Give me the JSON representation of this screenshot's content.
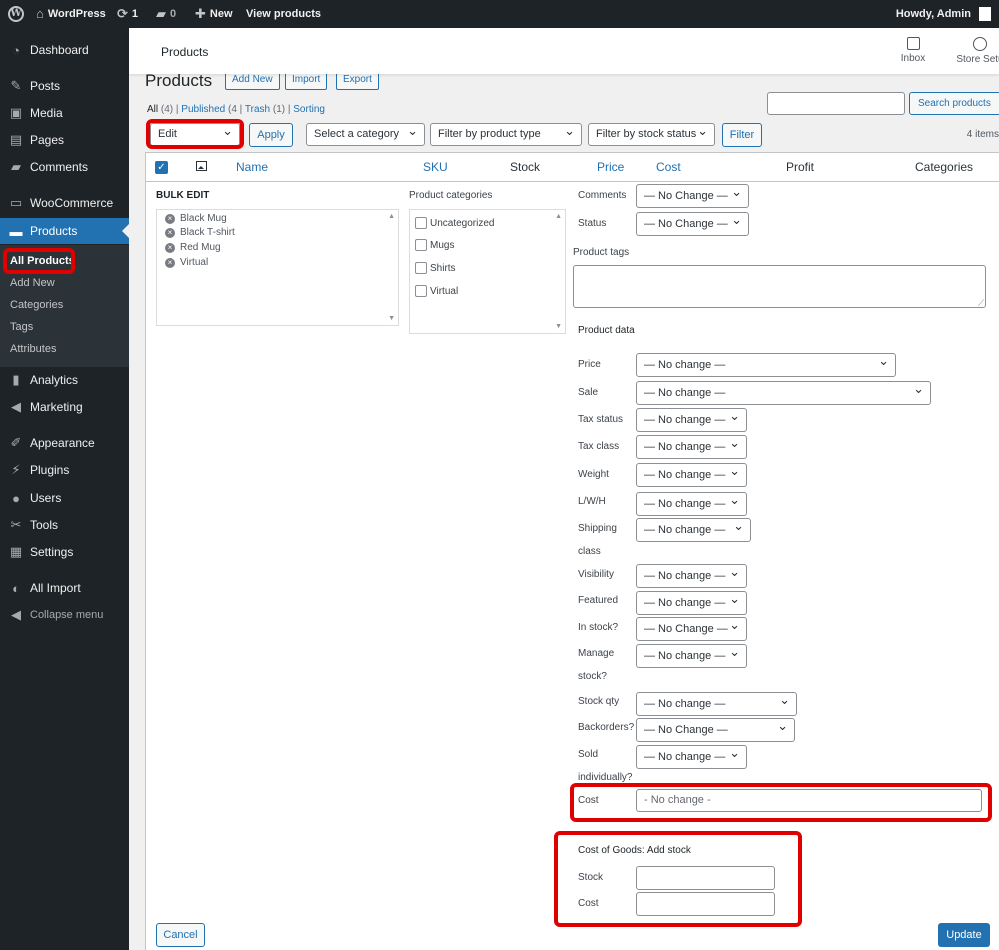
{
  "admin_bar": {
    "site_name": "WordPress",
    "updates_count": "1",
    "comments_count": "0",
    "new_label": "New",
    "view_label": "View products",
    "howdy": "Howdy, Admin"
  },
  "sidebar": {
    "items": [
      {
        "label": "Dashboard",
        "icon": "dashboard-icon"
      },
      {
        "label": "Posts",
        "icon": "pin-icon"
      },
      {
        "label": "Media",
        "icon": "media-icon"
      },
      {
        "label": "Pages",
        "icon": "pages-icon"
      },
      {
        "label": "Comments",
        "icon": "comment-icon"
      },
      {
        "label": "WooCommerce",
        "icon": "woo-icon"
      },
      {
        "label": "Products",
        "icon": "archive-icon"
      },
      {
        "label": "Analytics",
        "icon": "chart-icon"
      },
      {
        "label": "Marketing",
        "icon": "megaphone-icon"
      },
      {
        "label": "Appearance",
        "icon": "brush-icon"
      },
      {
        "label": "Plugins",
        "icon": "plug-icon"
      },
      {
        "label": "Users",
        "icon": "user-icon"
      },
      {
        "label": "Tools",
        "icon": "wrench-icon"
      },
      {
        "label": "Settings",
        "icon": "settings-icon"
      },
      {
        "label": "All Import",
        "icon": "import-icon"
      },
      {
        "label": "Collapse menu",
        "icon": "collapse-icon"
      }
    ],
    "submenu": [
      "All Products",
      "Add New",
      "Categories",
      "Tags",
      "Attributes"
    ]
  },
  "header": {
    "title": "Products",
    "inbox": "Inbox",
    "store_setup": "Store Setu"
  },
  "page": {
    "heading": "Products",
    "add_new": "Add New",
    "import": "Import",
    "export": "Export",
    "filters": {
      "all": "All",
      "all_count": "(4)",
      "published": "Published",
      "published_count": "(4",
      "trash": "Trash",
      "trash_count": "(1)",
      "sorting": "Sorting"
    },
    "search_button": "Search products",
    "bulk_action": "Edit",
    "apply": "Apply",
    "category_filter": "Select a category",
    "type_filter": "Filter by product type",
    "stock_filter": "Filter by stock status",
    "filter_button": "Filter",
    "items_count": "4 items"
  },
  "table": {
    "columns": [
      "Name",
      "SKU",
      "Stock",
      "Price",
      "Cost",
      "Profit",
      "Categories"
    ]
  },
  "bulk_edit": {
    "title": "BULK EDIT",
    "products": [
      "Black Mug",
      "Black T-shirt",
      "Red Mug",
      "Virtual"
    ],
    "categories_label": "Product categories",
    "categories": [
      "Uncategorized",
      "Mugs",
      "Shirts",
      "Virtual"
    ],
    "comments_label": "Comments",
    "comments_value": "— No Change —",
    "status_label": "Status",
    "status_value": "— No Change —",
    "tags_label": "Product tags",
    "product_data_label": "Product data",
    "price_label": "Price",
    "price_value": "— No change —",
    "sale_label": "Sale",
    "sale_value": "— No change —",
    "tax_status_label": "Tax status",
    "tax_status_value": "— No change —",
    "tax_class_label": "Tax class",
    "tax_class_value": "— No change —",
    "weight_label": "Weight",
    "weight_value": "— No change —",
    "lwh_label": "L/W/H",
    "lwh_value": "— No change —",
    "shipping_label_1": "Shipping",
    "shipping_label_2": "class",
    "shipping_value": "— No change —",
    "visibility_label": "Visibility",
    "visibility_value": "— No change —",
    "featured_label": "Featured",
    "featured_value": "— No change —",
    "in_stock_label": "In stock?",
    "in_stock_value": "— No Change —",
    "manage_label_1": "Manage",
    "manage_label_2": "stock?",
    "manage_value": "— No change —",
    "stock_qty_label": "Stock qty",
    "stock_qty_value": "— No change —",
    "backorders_label": "Backorders?",
    "backorders_value": "— No Change —",
    "sold_label_1": "Sold",
    "sold_label_2": "individually?",
    "sold_value": "— No change —",
    "cost_label": "Cost",
    "cost_placeholder": "- No change -",
    "cog_title": "Cost of Goods: Add stock",
    "cog_stock_label": "Stock",
    "cog_cost_label": "Cost",
    "cancel": "Cancel",
    "update": "Update"
  }
}
